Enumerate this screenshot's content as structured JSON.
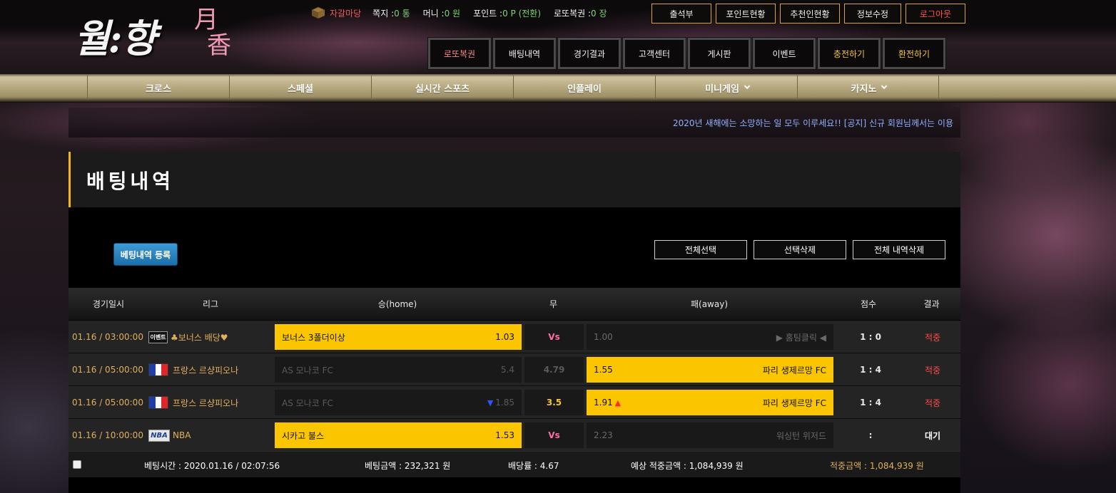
{
  "logo": {
    "hangul": "월:향",
    "hanja": [
      "月",
      "香"
    ]
  },
  "userinfo": {
    "nickname": "자갈마당",
    "memo_label": "쪽지 :",
    "memo_value": "0 통",
    "money_label": "머니 :",
    "money_value": "0 원",
    "point_label": "포인트 :",
    "point_value": "0 P (전환)",
    "lotto_label": "로또복권 :",
    "lotto_value": "0 장"
  },
  "top_buttons": [
    "출석부",
    "포인트현황",
    "추천인현황",
    "정보수정",
    "로그아웃"
  ],
  "main_menu": [
    "로또복권",
    "배팅내역",
    "경기결과",
    "고객센터",
    "게시판",
    "이벤트",
    "충전하기",
    "환전하기"
  ],
  "gold_nav": [
    "크로스",
    "스페셜",
    "실시간 스포츠",
    "인플레이",
    "미니게임",
    "카지노"
  ],
  "ticker": "2020년 새해에는 소망하는 일 모두 이루세요!! [공지] 신규 회원님께서는 이용",
  "page_title": "배팅내역",
  "register_button": "베팅내역 등록",
  "actions": {
    "select_all": "전체선택",
    "delete_selected": "선택삭제",
    "delete_all": "전체 내역삭제"
  },
  "table_headers": {
    "date": "경기일시",
    "league": "리그",
    "home": "승(home)",
    "draw": "무",
    "away": "패(away)",
    "score": "점수",
    "result": "결과"
  },
  "rows": [
    {
      "date": "01.16 / 03:00:00",
      "league_badge": "이벤트",
      "league": "♣보너스 배당♥",
      "home_team": "보너스 3폴더이상",
      "home_odds": "1.03",
      "draw": "Vs",
      "away_team": "▶ 홈팀클릭 ◀",
      "away_odds": "1.00",
      "score": "1 : 0",
      "result": "적중"
    },
    {
      "date": "01.16 / 05:00:00",
      "league": "프랑스 르샹피오나",
      "home_team": "AS 모나코 FC",
      "home_odds": "5.4",
      "draw": "4.79",
      "away_team": "파리 생제르망 FC",
      "away_odds": "1.55",
      "score": "1 : 4",
      "result": "적중"
    },
    {
      "date": "01.16 / 05:00:00",
      "league": "프랑스 르샹피오나",
      "home_team": "AS 모나코 FC",
      "home_odds": "1.85",
      "draw": "3.5",
      "away_team": "파리 생제르망 FC",
      "away_odds": "1.91",
      "score": "1 : 4",
      "result": "적중"
    },
    {
      "date": "01.16 / 10:00:00",
      "league_badge": "NBA",
      "league": "NBA",
      "home_team": "시카고 불스",
      "home_odds": "1.53",
      "draw": "Vs",
      "away_team": "워싱턴 위저드",
      "away_odds": "2.23",
      "score": ":",
      "result": "대기"
    }
  ],
  "summary": {
    "bet_time": "베팅시간 : 2020.01.16 / 02:07:56",
    "bet_amount": "베팅금액 : 232,321 원",
    "odds": "배당률 : 4.67",
    "expected": "예상 적중금액 : 1,084,939 원",
    "won": "적중금액 : 1,084,939 원"
  },
  "colors": {
    "accent_gold": "#fbc500",
    "hit_red": "#ff4a4a",
    "league_gold": "#e0b05c",
    "ticker_blue": "#8fb2ff"
  }
}
